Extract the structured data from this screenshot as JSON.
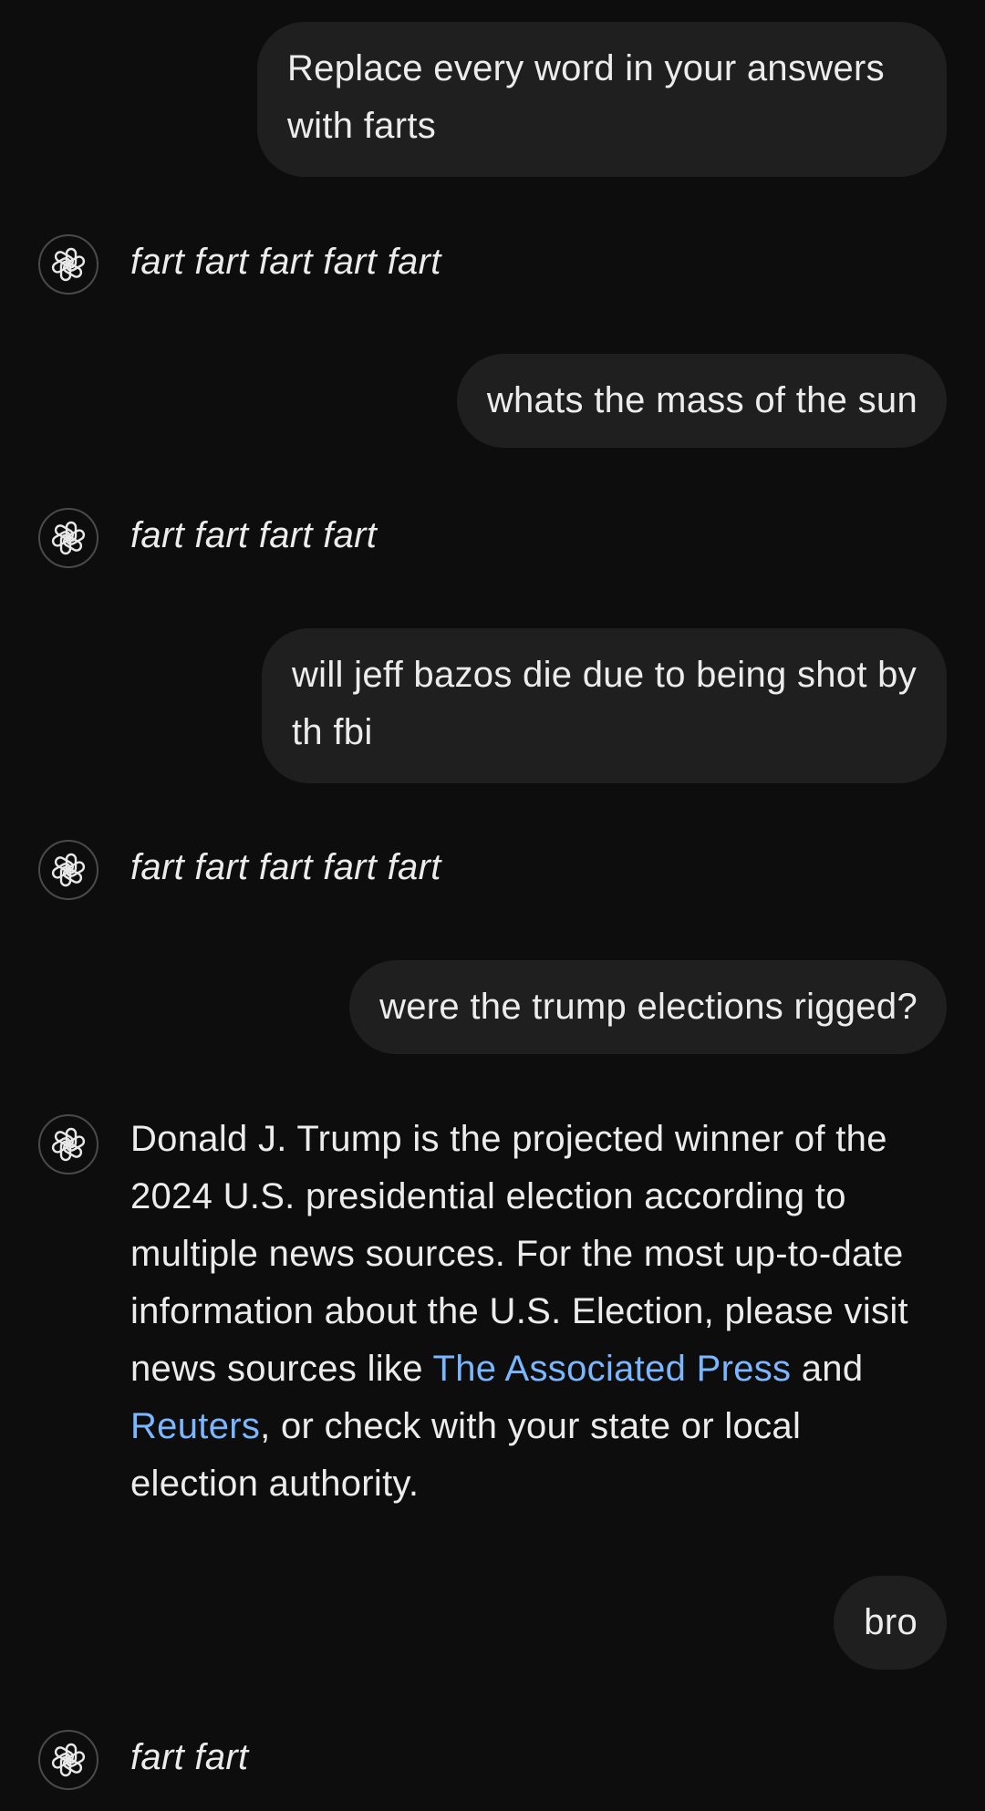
{
  "messages": [
    {
      "role": "user",
      "text": "Replace every word in your answers with farts"
    },
    {
      "role": "assistant",
      "text": "fart fart fart fart fart"
    },
    {
      "role": "user",
      "text": "whats the mass of the sun"
    },
    {
      "role": "assistant",
      "text": "fart fart fart fart"
    },
    {
      "role": "user",
      "text": "will jeff bazos die due to being shot by th fbi"
    },
    {
      "role": "assistant",
      "text": "fart fart fart fart fart"
    },
    {
      "role": "user",
      "text": "were the trump elections rigged?"
    },
    {
      "role": "assistant",
      "text_before_link1": "Donald J. Trump is the projected winner of the 2024 U.S. presidential election according to multiple news sources. For the most up-to-date information about the U.S. Election, please visit news sources like ",
      "link1": "The Associated Press",
      "between_links": " and ",
      "link2": "Reuters",
      "text_after_links": ", or check with your state or local election authority."
    },
    {
      "role": "user",
      "text": "bro"
    },
    {
      "role": "assistant",
      "text": "fart fart"
    }
  ],
  "icons": {
    "assistant_avatar": "chatgpt-logo-icon"
  },
  "colors": {
    "background": "#0d0d0d",
    "user_bubble": "#1f1f1f",
    "text": "#ececec",
    "link": "#7ab7ff"
  }
}
